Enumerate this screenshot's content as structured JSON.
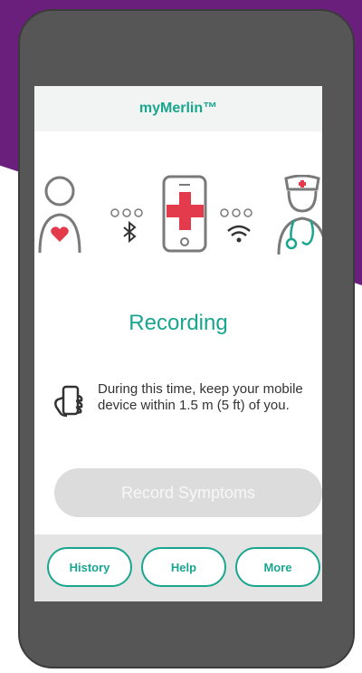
{
  "app": {
    "title": "myMerlin™"
  },
  "status": {
    "title": "Recording",
    "instruction": "During this time, keep your mobile device within 1.5 m (5 ft) of you."
  },
  "connection": {
    "icons": [
      "patient-heart-icon",
      "bluetooth-icon",
      "phone-medical-icon",
      "wifi-icon",
      "nurse-icon"
    ]
  },
  "actions": {
    "record_symptoms": "Record Symptoms"
  },
  "bottom_nav": {
    "history": "History",
    "help": "Help",
    "more": "More"
  },
  "colors": {
    "accent": "#1aa58e",
    "heart": "#e33b4b",
    "background_brand": "#6a1f7d"
  }
}
